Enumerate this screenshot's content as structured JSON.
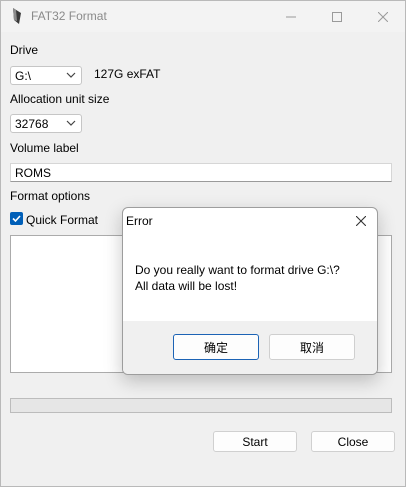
{
  "window": {
    "title": "FAT32 Format"
  },
  "form": {
    "drive_label": "Drive",
    "drive_value": "G:\\",
    "drive_info": "127G exFAT",
    "alloc_label": "Allocation unit size",
    "alloc_value": "32768",
    "volume_label": "Volume label",
    "volume_value": "ROMS",
    "options_label": "Format options",
    "quick_format_label": "Quick Format",
    "quick_format_checked": true
  },
  "buttons": {
    "start": "Start",
    "close": "Close"
  },
  "dialog": {
    "title": "Error",
    "line1": "Do you really want to format drive G:\\?",
    "line2": "All data will be lost!",
    "ok": "确定",
    "cancel": "取消"
  },
  "colors": {
    "accent": "#005fb8",
    "dialog_default_border": "#1c63b5"
  }
}
